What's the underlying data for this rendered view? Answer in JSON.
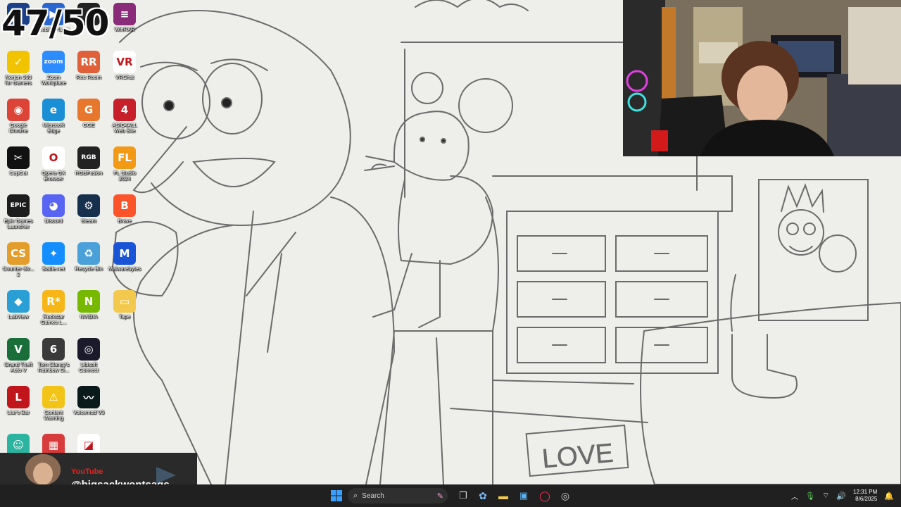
{
  "counter": "47/50",
  "desktop_icons": [
    {
      "label": "",
      "glyph": "P",
      "bg": "#1c3f8a"
    },
    {
      "label": "Mobile Player",
      "glyph": "▶",
      "bg": "#2a66d0"
    },
    {
      "label": "",
      "glyph": "•",
      "bg": "#222222"
    },
    {
      "label": "WinRAR",
      "glyph": "≡",
      "bg": "#8a2b7a"
    },
    {
      "label": "Norton 360\nfor Gamers",
      "glyph": "✓",
      "bg": "#f2c400"
    },
    {
      "label": "Zoom\nWorkplace",
      "glyph": "zoom",
      "bg": "#2d8cff"
    },
    {
      "label": "Rec Room",
      "glyph": "RR",
      "bg": "#e0603a"
    },
    {
      "label": "VRChat",
      "glyph": "VR",
      "bg": "#ffffff"
    },
    {
      "label": "Google\nChrome",
      "glyph": "◉",
      "bg": "#db4437"
    },
    {
      "label": "Microsoft\nEdge",
      "glyph": "e",
      "bg": "#1a8fd6"
    },
    {
      "label": "GGE",
      "glyph": "G",
      "bg": "#e7772d"
    },
    {
      "label": "ASIO4ALL\nWeb Site",
      "glyph": "4",
      "bg": "#c8202a"
    },
    {
      "label": "CapCut",
      "glyph": "✂",
      "bg": "#111111"
    },
    {
      "label": "Opera GX\nBrowser",
      "glyph": "O",
      "bg": "#ffffff"
    },
    {
      "label": "RGBFusion",
      "glyph": "RGB",
      "bg": "#222222"
    },
    {
      "label": "FL Studio\n2024",
      "glyph": "FL",
      "bg": "#f29a16"
    },
    {
      "label": "Epic Games\nLauncher",
      "glyph": "EPIC",
      "bg": "#1d1d1d"
    },
    {
      "label": "Discord",
      "glyph": "◕",
      "bg": "#5865f2"
    },
    {
      "label": "Steam",
      "glyph": "⚙",
      "bg": "#17304e"
    },
    {
      "label": "Brave",
      "glyph": "B",
      "bg": "#fb542b"
    },
    {
      "label": "Counter-Str...\n2",
      "glyph": "CS",
      "bg": "#e39d2a"
    },
    {
      "label": "Battle.net",
      "glyph": "✦",
      "bg": "#148eff"
    },
    {
      "label": "Recycle Bin",
      "glyph": "♻",
      "bg": "#4aa0d8"
    },
    {
      "label": "Malwarebytes",
      "glyph": "M",
      "bg": "#1a54d6"
    },
    {
      "label": "LabView",
      "glyph": "◆",
      "bg": "#2a9fd6"
    },
    {
      "label": "Rockstar\nGames L...",
      "glyph": "R*",
      "bg": "#f6b618"
    },
    {
      "label": "NVIDIA",
      "glyph": "N",
      "bg": "#76b900"
    },
    {
      "label": "Tape",
      "glyph": "▭",
      "bg": "#f2c94c"
    },
    {
      "label": "Grand Theft\nAuto V",
      "glyph": "V",
      "bg": "#1a6e3a"
    },
    {
      "label": "Tom Clancy's\nRainbow Si...",
      "glyph": "6",
      "bg": "#3a3a3a"
    },
    {
      "label": "Ubisoft\nConnect",
      "glyph": "◎",
      "bg": "#1a1a2a"
    },
    {
      "label": "",
      "glyph": "",
      "bg": "transparent"
    },
    {
      "label": "Liar's Bar",
      "glyph": "L",
      "bg": "#c0151b"
    },
    {
      "label": "Content\nWarning",
      "glyph": "⚠",
      "bg": "#f2c418"
    },
    {
      "label": "Voicemod V3",
      "glyph": "〰",
      "bg": "#0a1a1a"
    },
    {
      "label": "",
      "glyph": "",
      "bg": "transparent"
    },
    {
      "label": "",
      "glyph": "☺",
      "bg": "#2bb5a0"
    },
    {
      "label": "",
      "glyph": "▦",
      "bg": "#d83b3b"
    },
    {
      "label": "",
      "glyph": "◪",
      "bg": "#ffffff"
    }
  ],
  "wallpaper_text": "LOVE",
  "banner": {
    "platform": "YouTube",
    "handle": "@bigsackwontsags"
  },
  "taskbar": {
    "search_placeholder": "Search",
    "time": "12:31 PM",
    "date": "8/6/2025"
  }
}
